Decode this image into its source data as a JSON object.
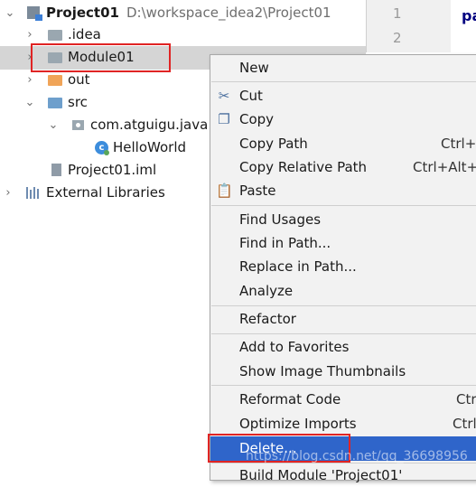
{
  "tree": {
    "root": {
      "name": "Project01",
      "path": "D:\\workspace_idea2\\Project01"
    },
    "items": [
      {
        "label": ".idea"
      },
      {
        "label": "Module01"
      },
      {
        "label": "out"
      },
      {
        "label": "src"
      },
      {
        "label": "com.atguigu.java"
      },
      {
        "label": "HelloWorld"
      },
      {
        "label": "Project01.iml"
      },
      {
        "label": "External Libraries"
      }
    ]
  },
  "editor": {
    "line_numbers": [
      "1",
      "2"
    ],
    "code_fragment": "pa"
  },
  "context_menu": {
    "items": [
      {
        "label": "New"
      },
      {
        "label": "Cut",
        "icon": "scissors-icon"
      },
      {
        "label": "Copy",
        "icon": "copy-icon"
      },
      {
        "label": "Copy Path",
        "shortcut": "Ctrl+"
      },
      {
        "label": "Copy Relative Path",
        "shortcut": "Ctrl+Alt+"
      },
      {
        "label": "Paste",
        "icon": "paste-icon"
      },
      {
        "label": "Find Usages"
      },
      {
        "label": "Find in Path..."
      },
      {
        "label": "Replace in Path..."
      },
      {
        "label": "Analyze"
      },
      {
        "label": "Refactor"
      },
      {
        "label": "Add to Favorites"
      },
      {
        "label": "Show Image Thumbnails"
      },
      {
        "label": "Reformat Code",
        "shortcut": "Ctr"
      },
      {
        "label": "Optimize Imports",
        "shortcut": "Ctrl"
      },
      {
        "label": "Delete..."
      },
      {
        "label": "Build Module 'Project01'"
      }
    ]
  },
  "watermark": "https://blog.csdn.net/qq_36698956",
  "colors": {
    "selection": "#2f65ca",
    "highlight_box": "#e02424",
    "menu_bg": "#f2f2f2"
  }
}
